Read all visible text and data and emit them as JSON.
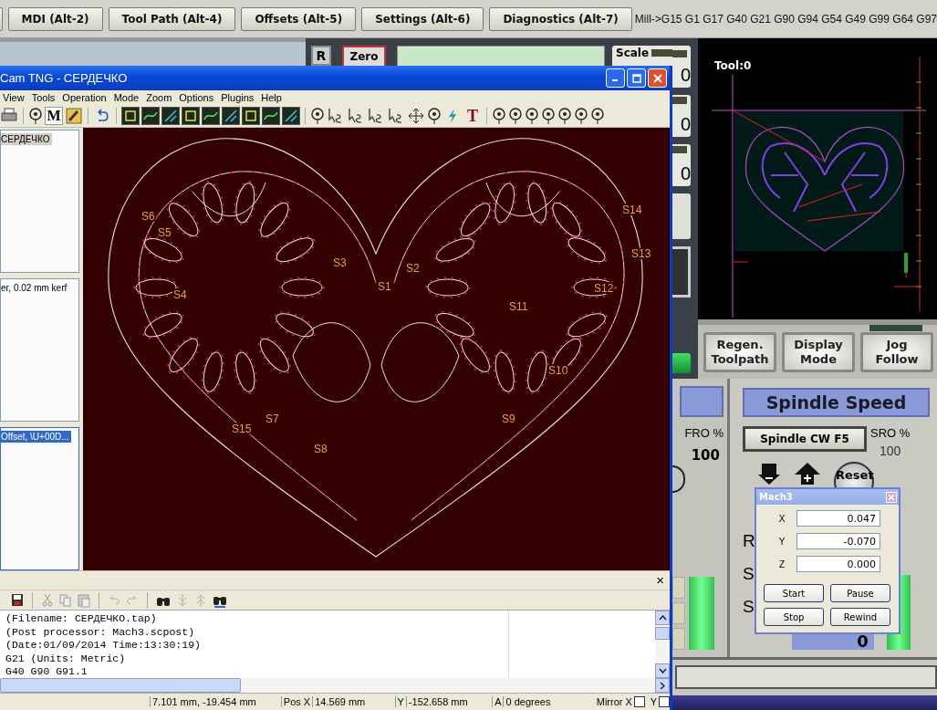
{
  "mach3": {
    "tabs": [
      {
        "label": "MDI (Alt-2)",
        "selected": false
      },
      {
        "label": "Tool Path (Alt-4)",
        "selected": false
      },
      {
        "label": "Offsets (Alt-5)",
        "selected": false
      },
      {
        "label": "Settings (Alt-6)",
        "selected": false
      },
      {
        "label": "Diagnostics (Alt-7)",
        "selected": false
      }
    ],
    "modal_codes": "Mill->G15  G1 G17 G40 G21 G90 G94 G54 G49 G99 G64 G97",
    "dro": {
      "r_button": "R",
      "zero_button": "Zero",
      "scale_label": "Scale",
      "scale_values": [
        "0",
        "0",
        "0"
      ]
    },
    "toolpath": {
      "tool_label": "Tool:0"
    },
    "view_buttons": [
      "Regen. Toolpath",
      "Display Mode",
      "Jog Follow"
    ],
    "fro": {
      "label": "FRO %",
      "value": "100"
    },
    "spindle": {
      "title": "Spindle Speed",
      "cw_button": "Spindle CW F5",
      "sro_label": "SRO %",
      "sro_value": "100",
      "reset_button": "Reset",
      "row_letters": [
        "R",
        "S",
        "S"
      ],
      "speed_value": "0"
    }
  },
  "sheetcam": {
    "title": "Cam TNG - СЕРДЕЧКО",
    "menu": [
      "View",
      "Tools",
      "Operation",
      "Mode",
      "Zoom",
      "Options",
      "Plugins",
      "Help"
    ],
    "toolbar_letters": [
      "M",
      "T"
    ],
    "panels": [
      {
        "focused": false,
        "items": [
          {
            "label": "СЕРДЕЧКО",
            "selected": true
          }
        ]
      },
      {
        "focused": false,
        "items": [
          {
            "label": "er, 0.02 mm kerf",
            "selected": false
          }
        ]
      },
      {
        "focused": true,
        "items": [
          {
            "label": "Offset, \\U+00D...",
            "selected": true
          }
        ]
      }
    ],
    "canvas": {
      "labels": [
        "S6",
        "S5",
        "S4",
        "S3",
        "S2",
        "S1",
        "S11",
        "S12",
        "S13",
        "S14",
        "S10",
        "S9",
        "S8",
        "S7",
        "S15"
      ]
    },
    "code_close": "×",
    "code_lines": [
      "(Filename: СЕРДЕЧКО.tap)",
      "(Post processor: Mach3.scpost)",
      "(Date:01/09/2014 Time:13:30:19)",
      "G21 (Units: Metric)",
      "G40 G90 G91.1"
    ],
    "status": {
      "cursor": "7.101 mm, -19.454 mm",
      "pos_x_label": "Pos X",
      "pos_x": "14.569 mm",
      "y_label": "Y",
      "pos_y": "-152.658 mm",
      "a_label": "A",
      "angle": "0 degrees",
      "mirror_x_label": "Mirror X",
      "mirror_x": false,
      "mirror_y_label": "Y",
      "mirror_y": false
    }
  },
  "dialog": {
    "title": "Mach3",
    "fields": [
      {
        "label": "X",
        "value": "0.047"
      },
      {
        "label": "Y",
        "value": "-0.070"
      },
      {
        "label": "Z",
        "value": "0.000"
      }
    ],
    "buttons": [
      "Start",
      "Pause",
      "Stop",
      "Rewind"
    ]
  }
}
